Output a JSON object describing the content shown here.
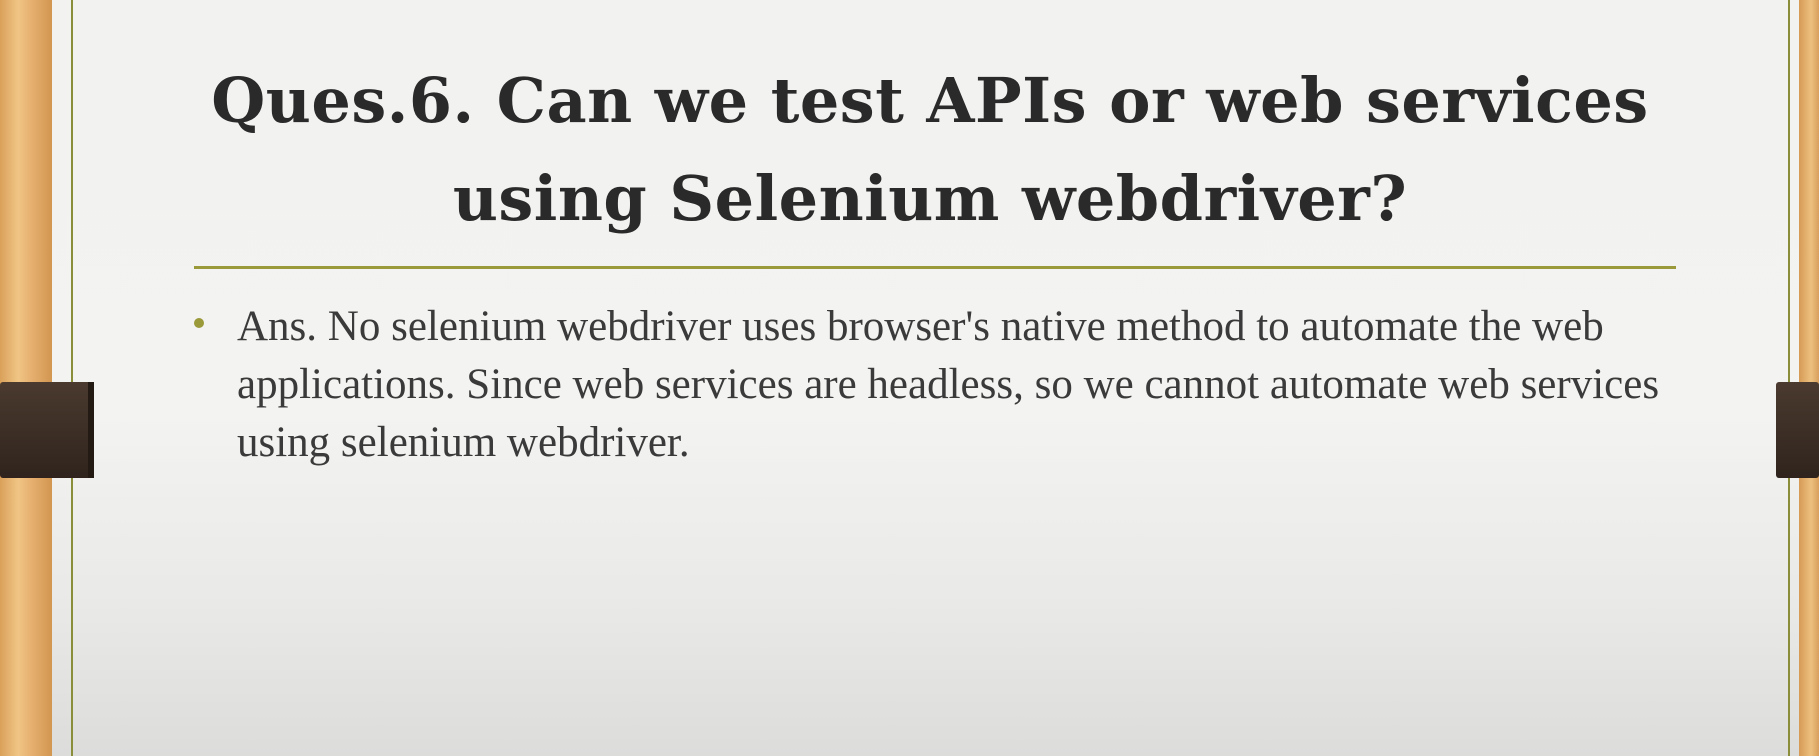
{
  "slide": {
    "title": "Ques.6. Can we test APIs or web services using Selenium webdriver?",
    "bullets": [
      "Ans. No selenium webdriver uses browser's native method to automate the web applications. Since web services are headless, so we cannot automate web services using selenium webdriver."
    ]
  },
  "colors": {
    "accent": "#9a9a3a",
    "title_text": "#2a2a2a",
    "body_text": "#3a3a3a",
    "binder_clip": "#3d2f26",
    "wood": "#e6b070"
  }
}
